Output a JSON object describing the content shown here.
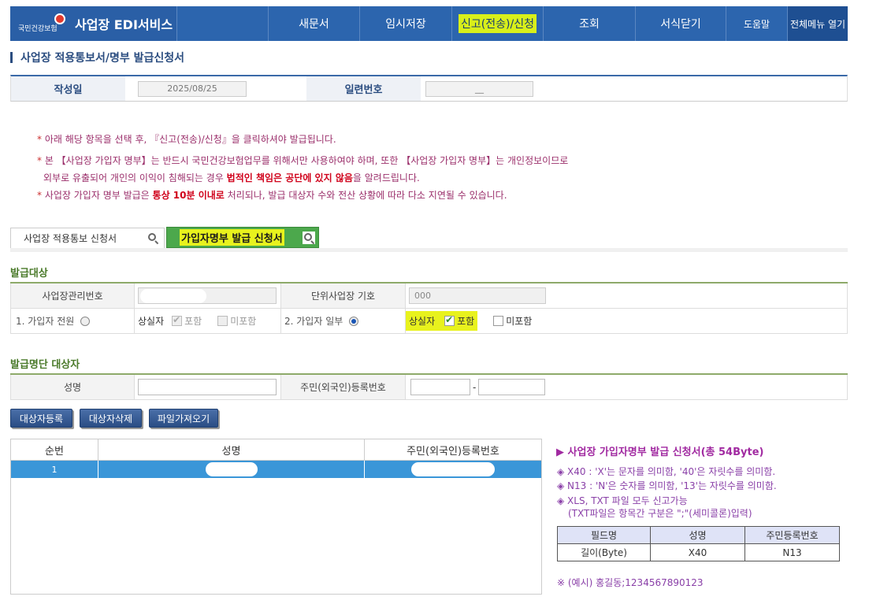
{
  "nav": {
    "logo_text": "국민건강보험",
    "brand": "사업장 EDI서비스",
    "menus": [
      "새문서",
      "임시저장",
      "신고(전송)/신청",
      "조회",
      "서식닫기",
      "도움말",
      "전체메뉴 열기"
    ]
  },
  "page_title": "사업장 적용통보서/명부 발급신청서",
  "info": {
    "date_label": "작성일",
    "date_value": "2025/08/25",
    "serial_label": "일련번호",
    "serial_value": "__"
  },
  "notices": [
    {
      "prefix": "* ",
      "text": "아래 해당 항목을 선택 후, 『신고(전송)/신청』을 클릭하셔야 발급됩니다."
    },
    {
      "prefix": "* ",
      "text": "본 【사업장 가입자 명부】는 반드시 국민건강보험업무를 위해서만 사용하여야 하며, 또한 【사업장 가입자 명부】는 개인정보이므로"
    },
    {
      "prefix": "",
      "text_before": "외부로 유출되어 개인의 이익이 침해되는 경우 ",
      "bold": "법적인 책임은 공단에 있지 않음",
      "text_after": "을 알려드립니다."
    },
    {
      "prefix": "* ",
      "text_before": "사업장 가입자 명부 발급은 ",
      "bold": "통상 10분 이내로",
      "text_after": " 처리되나, 발급 대상자 수와 전산 상황에 따라 다소 지연될 수 있습니다."
    }
  ],
  "tabs": {
    "tab1": "사업장 적용통보 신청서",
    "tab2": "가입자명부 발급 신청서"
  },
  "target": {
    "section_title": "발급대상",
    "biz_no_label": "사업장관리번호",
    "unit_label": "단위사업장 기호",
    "unit_value": "000",
    "opt_all_label": "1. 가입자 전원",
    "opt_part_label": "2. 가입자 일부",
    "lost_label": "상실자",
    "include_label": "포함",
    "exclude_label": "미포함"
  },
  "person": {
    "section_title": "발급명단 대상자",
    "name_label": "성명",
    "rrn_label": "주민(외국인)등록번호",
    "rrn_sep": "-"
  },
  "buttons": {
    "add": "대상자등록",
    "delete": "대상자삭제",
    "import": "파일가져오기"
  },
  "list": {
    "columns": [
      "순번",
      "성명",
      "주민(외국인)등록번호"
    ],
    "rows": [
      {
        "no": "1"
      }
    ]
  },
  "side": {
    "title": "▶ 사업장 가입자명부 발급 신청서(총 54Byte)",
    "lines": [
      "◈ X40 : 'X'는 문자를 의미함, '40'은 자릿수를 의미함.",
      "◈ N13 : 'N'은 숫자를 의미함, '13'는 자릿수를 의미함.",
      "◈ XLS, TXT 파일 모두 신고가능",
      "(TXT파일은 항목간 구분은 \";\"(세미콜론)입력)"
    ],
    "spec_head": [
      "필드명",
      "성명",
      "주민등록번호"
    ],
    "spec_row": [
      "길이(Byte)",
      "X40",
      "N13"
    ],
    "example": "※ (예시) 홍길동;1234567890123"
  },
  "colors": {
    "nav_bg": "#2c65ae",
    "highlight": "#d8ef1a",
    "tab_active": "#4ca84c",
    "row_selected": "#3a96d8",
    "notice": "#9b2f6b"
  }
}
